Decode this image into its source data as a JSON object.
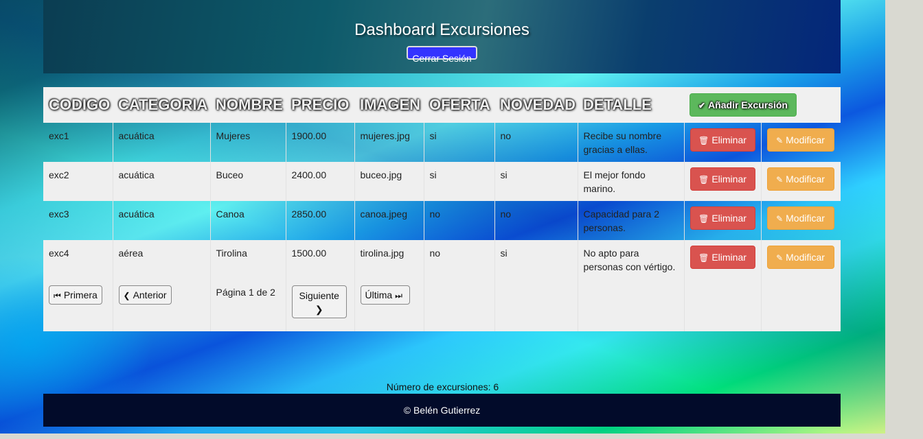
{
  "header": {
    "title": "Dashboard Excursiones",
    "logout_label": "Cerrar Sesión"
  },
  "table": {
    "columns": [
      "CODIGO",
      "CATEGORIA",
      "NOMBRE",
      "PRECIO",
      "IMAGEN",
      "OFERTA",
      "NOVEDAD",
      "DETALLE"
    ],
    "add_label": "Añadir Excursión",
    "delete_label": "Eliminar",
    "modify_label": "Modificar",
    "rows": [
      {
        "codigo": "exc1",
        "categoria": "acuática",
        "nombre": "Mujeres",
        "precio": "1900.00",
        "imagen": "mujeres.jpg",
        "oferta": "si",
        "novedad": "no",
        "detalle": "Recibe su nombre gracias a ellas."
      },
      {
        "codigo": "exc2",
        "categoria": "acuática",
        "nombre": "Buceo",
        "precio": "2400.00",
        "imagen": "buceo.jpg",
        "oferta": "si",
        "novedad": "si",
        "detalle": "El mejor fondo marino."
      },
      {
        "codigo": "exc3",
        "categoria": "acuática",
        "nombre": "Canoa",
        "precio": "2850.00",
        "imagen": "canoa.jpeg",
        "oferta": "no",
        "novedad": "no",
        "detalle": "Capacidad para 2 personas."
      },
      {
        "codigo": "exc4",
        "categoria": "aérea",
        "nombre": "Tirolina",
        "precio": "1500.00",
        "imagen": "tirolina.jpg",
        "oferta": "no",
        "novedad": "si",
        "detalle": "No apto para personas con vértigo."
      }
    ]
  },
  "pagination": {
    "first_label": "Primera",
    "prev_label": "Anterior",
    "page_info": "Página 1 de 2",
    "next_label": "Siguiente",
    "last_label": "Última"
  },
  "summary": {
    "count_text": "Número de excursiones: 6"
  },
  "footer": {
    "text": "© Belén Gutierrez"
  },
  "colors": {
    "header_bg": "#0b3d52",
    "footer_bg": "#020b2a",
    "logout_bg": "#3433ff",
    "add": "#5cb85c",
    "delete": "#d9534f",
    "modify": "#f0ad4e"
  },
  "icons": {
    "add": "check-icon",
    "delete": "trash-icon",
    "modify": "pencil-icon",
    "first": "step-backward-icon",
    "prev": "chevron-left-icon",
    "next": "chevron-right-icon",
    "last": "step-forward-icon"
  }
}
